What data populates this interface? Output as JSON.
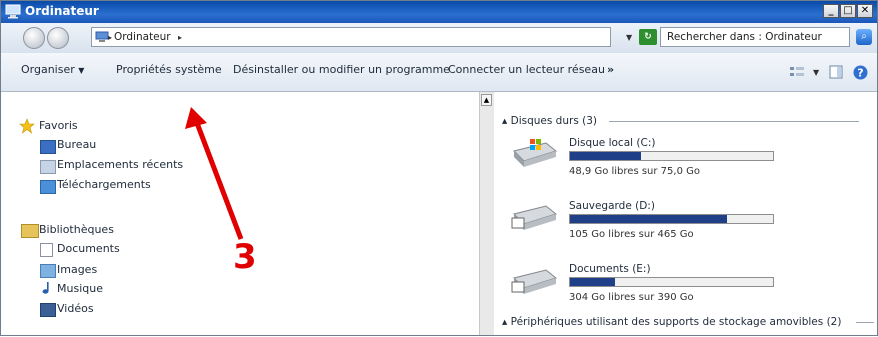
{
  "window": {
    "title": "Ordinateur",
    "minimize": "_",
    "maximize": "□",
    "close": "✕"
  },
  "address": {
    "crumb": "Ordinateur",
    "search_placeholder": "Rechercher dans : Ordinateur"
  },
  "toolbar": {
    "organiser": "Organiser",
    "proprietes": "Propriétés système",
    "desinstaller": "Désinstaller ou modifier un programme",
    "connecter": "Connecter un lecteur réseau",
    "more": "»"
  },
  "nav": {
    "favoris": "Favoris",
    "favoris_items": [
      "Bureau",
      "Emplacements récents",
      "Téléchargements"
    ],
    "bibliotheques": "Bibliothèques",
    "bibliotheques_items": [
      "Documents",
      "Images",
      "Musique",
      "Vidéos"
    ]
  },
  "groups": {
    "disques": "Disques durs (3)",
    "peripheriques": "Périphériques utilisant des supports de stockage amovibles (2)"
  },
  "drives": [
    {
      "name": "Disque local (C:)",
      "free_text": "48,9 Go libres sur 75,0 Go",
      "used_fraction": 0.348
    },
    {
      "name": "Sauvegarde (D:)",
      "free_text": "105 Go libres sur 465 Go",
      "used_fraction": 0.774
    },
    {
      "name": "Documents (E:)",
      "free_text": "304 Go libres sur 390 Go",
      "used_fraction": 0.22
    }
  ],
  "annotation": {
    "number": "3"
  },
  "colors": {
    "title_bar": "#1b57b8",
    "drive_bar_fill": "#1f3f88",
    "annotation": "#e00000"
  }
}
